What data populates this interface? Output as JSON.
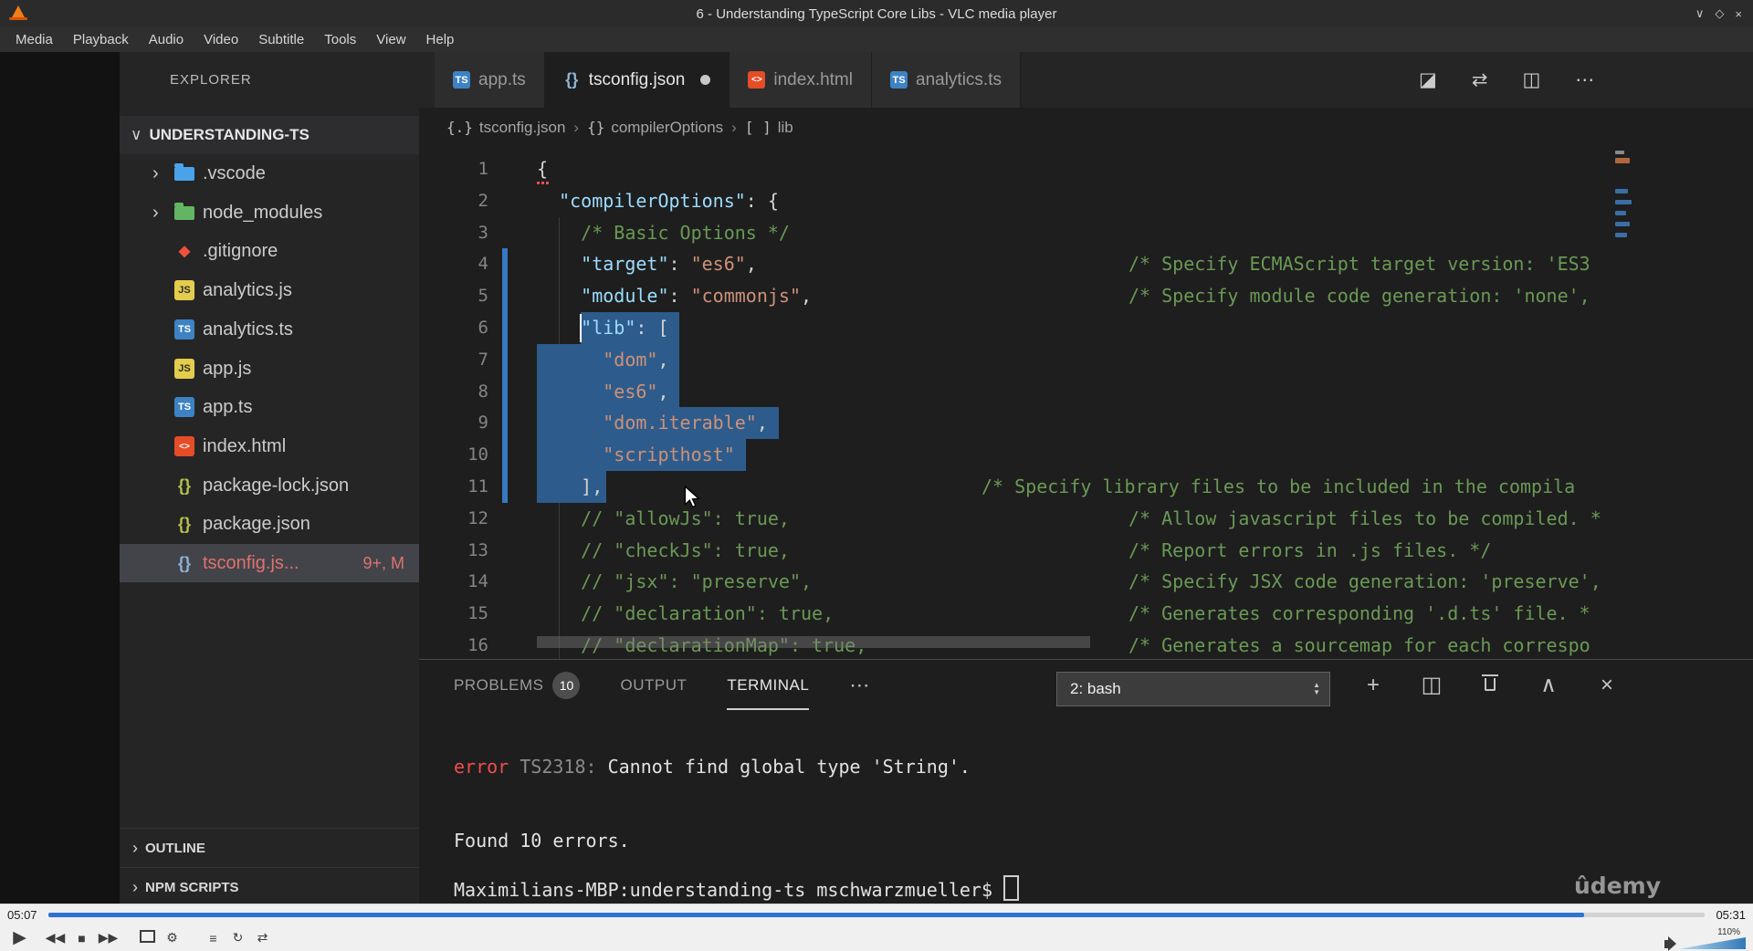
{
  "window": {
    "title": "6 - Understanding TypeScript Core Libs - VLC media player",
    "controls": {
      "minimize": "∨",
      "maximize": "◇",
      "close": "×"
    },
    "menu": [
      "Media",
      "Playback",
      "Audio",
      "Video",
      "Subtitle",
      "Tools",
      "View",
      "Help"
    ]
  },
  "explorer": {
    "header": "EXPLORER",
    "root": "UNDERSTANDING-TS",
    "root_chevron": "∨",
    "items": [
      {
        "label": ".vscode",
        "icon": "folder-vscode-icon",
        "chevron": "›"
      },
      {
        "label": "node_modules",
        "icon": "folder-node-icon",
        "chevron": "›"
      },
      {
        "label": ".gitignore",
        "icon": "git-icon"
      },
      {
        "label": "analytics.js",
        "icon": "js-icon"
      },
      {
        "label": "analytics.ts",
        "icon": "ts-icon"
      },
      {
        "label": "app.js",
        "icon": "js-icon"
      },
      {
        "label": "app.ts",
        "icon": "ts-icon"
      },
      {
        "label": "index.html",
        "icon": "html-icon"
      },
      {
        "label": "package-lock.json",
        "icon": "json-icon"
      },
      {
        "label": "package.json",
        "icon": "json-icon"
      },
      {
        "label": "tsconfig.js...",
        "icon": "tsconfig-icon",
        "selected": true,
        "badge": "9+, M"
      }
    ],
    "sections": [
      "OUTLINE",
      "NPM SCRIPTS"
    ]
  },
  "tabs": [
    {
      "label": "app.ts",
      "icon": "ts-icon"
    },
    {
      "label": "tsconfig.json",
      "icon": "tsconfig-icon",
      "active": true,
      "dirty": true
    },
    {
      "label": "index.html",
      "icon": "html-icon"
    },
    {
      "label": "analytics.ts",
      "icon": "ts-icon"
    }
  ],
  "editor_actions": [
    {
      "name": "open-changes-icon",
      "glyph": "◪"
    },
    {
      "name": "compare-icon",
      "glyph": "⇄"
    },
    {
      "name": "split-editor-icon",
      "glyph": "◫"
    },
    {
      "name": "more-actions-icon",
      "glyph": "⋯"
    }
  ],
  "breadcrumb": {
    "separator": "›",
    "items": [
      {
        "icon": "{.}",
        "label": "tsconfig.json"
      },
      {
        "icon": "{}",
        "label": "compilerOptions"
      },
      {
        "icon": "[ ]",
        "label": "lib"
      }
    ]
  },
  "code": {
    "lines": [
      {
        "n": "1",
        "tokens": [
          [
            "p",
            "{"
          ]
        ]
      },
      {
        "n": "2",
        "tokens": [
          [
            "p",
            "  "
          ],
          [
            "k",
            "\"compilerOptions\""
          ],
          [
            "p",
            ": {"
          ]
        ]
      },
      {
        "n": "3",
        "tokens": [
          [
            "c",
            "    /* Basic Options */"
          ]
        ]
      },
      {
        "n": "4",
        "tokens": [
          [
            "p",
            "    "
          ],
          [
            "k",
            "\"target\""
          ],
          [
            "p",
            ": "
          ],
          [
            "s",
            "\"es6\""
          ],
          [
            "p",
            ","
          ]
        ],
        "comment": "/* Specify ECMAScript target version: 'ES3",
        "cpos": "far"
      },
      {
        "n": "5",
        "tokens": [
          [
            "p",
            "    "
          ],
          [
            "k",
            "\"module\""
          ],
          [
            "p",
            ": "
          ],
          [
            "s",
            "\"commonjs\""
          ],
          [
            "p",
            ","
          ]
        ],
        "comment": "/* Specify module code generation: 'none',",
        "cpos": "far"
      },
      {
        "n": "6",
        "tokens": [
          [
            "p",
            "    "
          ],
          [
            "k",
            "\"lib\""
          ],
          [
            "p",
            ": ["
          ]
        ]
      },
      {
        "n": "7",
        "tokens": [
          [
            "p",
            "      "
          ],
          [
            "s",
            "\"dom\""
          ],
          [
            "p",
            ","
          ]
        ]
      },
      {
        "n": "8",
        "tokens": [
          [
            "p",
            "      "
          ],
          [
            "s",
            "\"es6\""
          ],
          [
            "p",
            ","
          ]
        ]
      },
      {
        "n": "9",
        "tokens": [
          [
            "p",
            "      "
          ],
          [
            "s",
            "\"dom.iterable\""
          ],
          [
            "p",
            ","
          ]
        ]
      },
      {
        "n": "10",
        "tokens": [
          [
            "p",
            "      "
          ],
          [
            "s",
            "\"scripthost\""
          ]
        ]
      },
      {
        "n": "11",
        "tokens": [
          [
            "p",
            "    ],"
          ]
        ],
        "comment": "/* Specify library files to be included in the compila",
        "cpos": "near"
      },
      {
        "n": "12",
        "tokens": [
          [
            "c",
            "    // \"allowJs\": true,"
          ]
        ],
        "comment": "/* Allow javascript files to be compiled. *",
        "cpos": "far"
      },
      {
        "n": "13",
        "tokens": [
          [
            "c",
            "    // \"checkJs\": true,"
          ]
        ],
        "comment": "/* Report errors in .js files. */",
        "cpos": "far"
      },
      {
        "n": "14",
        "tokens": [
          [
            "c",
            "    // \"jsx\": \"preserve\","
          ]
        ],
        "comment": "/* Specify JSX code generation: 'preserve',",
        "cpos": "far"
      },
      {
        "n": "15",
        "tokens": [
          [
            "c",
            "    // \"declaration\": true,"
          ]
        ],
        "comment": "/* Generates corresponding '.d.ts' file. *",
        "cpos": "far"
      },
      {
        "n": "16",
        "tokens": [
          [
            "c",
            "    // \"declarationMap\": true,"
          ]
        ],
        "comment": "/* Generates a sourcemap for each correspo",
        "cpos": "far"
      }
    ]
  },
  "panel": {
    "tabs": [
      {
        "label": "PROBLEMS",
        "badge": "10"
      },
      {
        "label": "OUTPUT"
      },
      {
        "label": "TERMINAL",
        "active": true
      }
    ],
    "more_glyph": "⋯",
    "dropdown": "2: bash",
    "actions": [
      {
        "name": "new-terminal-icon",
        "glyph": "+"
      },
      {
        "name": "split-terminal-icon",
        "glyph": "◫"
      },
      {
        "name": "kill-terminal-icon",
        "glyph": "trash"
      },
      {
        "name": "maximize-panel-icon",
        "glyph": "∧"
      },
      {
        "name": "close-panel-icon",
        "glyph": "×"
      }
    ],
    "terminal": [
      {
        "tokens": [
          [
            "err",
            "error"
          ],
          [
            "dim",
            " TS2318:"
          ],
          [
            "txt",
            " Cannot find global type 'String'."
          ]
        ]
      },
      {
        "tokens": [
          [
            "txt",
            "Found 10 errors."
          ]
        ]
      },
      {
        "tokens": [
          [
            "txt",
            "Maximilians-MBP:understanding-ts mschwarzmueller$"
          ]
        ],
        "cursor": true
      }
    ]
  },
  "watermark": "ûdemy",
  "player": {
    "elapsed": "05:07",
    "total": "05:31",
    "progress_pct": 92.7,
    "volume": "110%",
    "controls": [
      {
        "name": "play-button",
        "glyph": "▶",
        "cls": "play"
      },
      {
        "name": "previous-button",
        "glyph": "◀◀",
        "cls": "grp"
      },
      {
        "name": "stop-button",
        "glyph": "■",
        "cls": "grp"
      },
      {
        "name": "next-button",
        "glyph": "▶▶",
        "cls": "grp"
      },
      {
        "name": "fullscreen-button",
        "glyph": "",
        "cls": "sp1"
      },
      {
        "name": "extended-settings-button",
        "glyph": "⚙",
        "cls": ""
      },
      {
        "name": "playlist-button",
        "glyph": "≡",
        "cls": "sp2"
      },
      {
        "name": "loop-button",
        "glyph": "↻",
        "cls": ""
      },
      {
        "name": "random-button",
        "glyph": "⇄",
        "cls": ""
      }
    ]
  },
  "colors": {
    "accent_blue": "#2e72d2",
    "selection": "#2d5c8c",
    "error_red": "#f14c4c",
    "comment_green": "#6a9955",
    "key_blue": "#9cdcfe",
    "string_orange": "#ce9178"
  }
}
